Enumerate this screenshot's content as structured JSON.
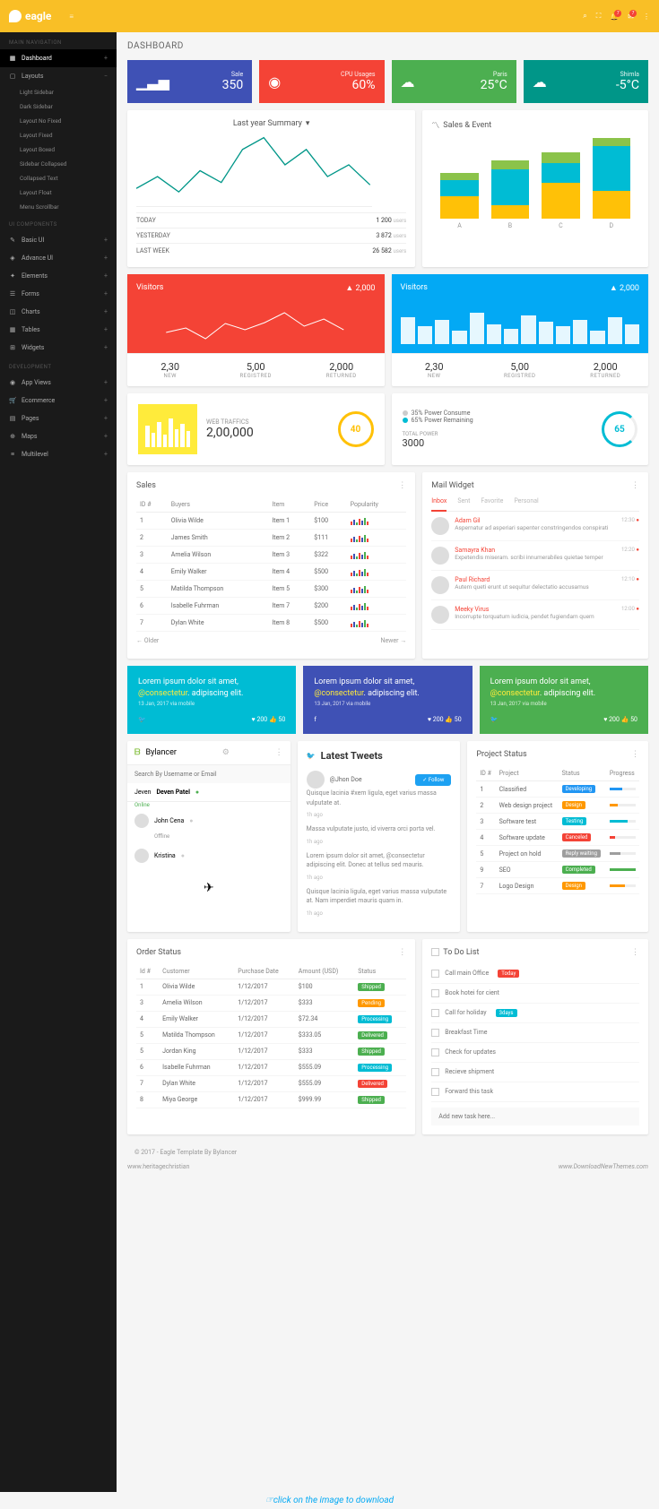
{
  "brand": "eagle",
  "topbar": {
    "notif1": "7",
    "notif2": "7"
  },
  "nav": {
    "header1": "MAIN NAVIGATION",
    "dashboard": "Dashboard",
    "layouts": "Layouts",
    "layout_sub": [
      "Light Sidebar",
      "Dark Sidebar",
      "Layout No Fixed",
      "Layout Fixed",
      "Layout Boxed",
      "Sidebar Collapsed",
      "Collapsed Text",
      "Layout Float",
      "Menu Scrollbar"
    ],
    "header2": "UI COMPONENTS",
    "items2": [
      "Basic UI",
      "Advance UI",
      "Elements",
      "Forms",
      "Charts",
      "Tables",
      "Widgets"
    ],
    "header3": "DEVELOPMENT",
    "items3": [
      "App Views",
      "Ecommerce",
      "Pages",
      "Maps",
      "Multilevel"
    ]
  },
  "page_title": "DASHBOARD",
  "stat_cards": [
    {
      "label": "Sale",
      "value": "350",
      "color": "c-blue"
    },
    {
      "label": "CPU Usages",
      "value": "60%",
      "color": "c-red"
    },
    {
      "label": "Paris",
      "value": "25°C",
      "color": "c-green"
    },
    {
      "label": "Shimla",
      "value": "-5°C",
      "color": "c-teal"
    }
  ],
  "summary": {
    "title": "Last year Summary",
    "rows": [
      {
        "label": "TODAY",
        "value": "1 200",
        "unit": "users"
      },
      {
        "label": "YESTERDAY",
        "value": "3 872",
        "unit": "users"
      },
      {
        "label": "LAST WEEK",
        "value": "26 582",
        "unit": "users"
      }
    ]
  },
  "sales_event": {
    "title": "Sales & Event",
    "labels": [
      "A",
      "B",
      "C",
      "D"
    ]
  },
  "chart_data": [
    {
      "type": "line",
      "title": "Last year Summary",
      "values": [
        25,
        40,
        20,
        45,
        30,
        60,
        85,
        50,
        72,
        40,
        55,
        35
      ]
    },
    {
      "type": "bar",
      "title": "Sales & Event",
      "categories": [
        "A",
        "B",
        "C",
        "D"
      ],
      "series": [
        {
          "name": "s1",
          "values": [
            25,
            15,
            40,
            35
          ],
          "color": "#ffc107"
        },
        {
          "name": "s2",
          "values": [
            18,
            40,
            22,
            55
          ],
          "color": "#00bcd4"
        },
        {
          "name": "s3",
          "values": [
            8,
            10,
            12,
            10
          ],
          "color": "#8bc34a"
        }
      ]
    },
    {
      "type": "line",
      "title": "Visitors-red",
      "values": [
        30,
        40,
        20,
        50,
        35,
        55,
        80,
        45,
        60,
        40
      ]
    },
    {
      "type": "bar",
      "title": "Visitors-blue",
      "values": [
        60,
        40,
        55,
        30,
        70,
        45,
        35,
        65,
        50,
        40,
        55,
        30,
        60,
        45
      ]
    }
  ],
  "visitors": {
    "title": "Visitors",
    "value": "2,000",
    "arrow": "▲",
    "cols": [
      {
        "num": "2,30",
        "lbl": "NEW"
      },
      {
        "num": "5,00",
        "lbl": "REGISTRED"
      },
      {
        "num": "2,000",
        "lbl": "RETURNED"
      }
    ]
  },
  "traffic": {
    "label": "WEB TRAFFICS",
    "value": "2,00,000",
    "circle": "40"
  },
  "power": {
    "consume": "35% Power Consume",
    "remain": "65% Power Remaining",
    "total_lbl": "TOTAL POWER",
    "total": "3000",
    "circle": "65"
  },
  "sales_table": {
    "title": "Sales",
    "cols": [
      "ID #",
      "Buyers",
      "Item",
      "Price",
      "Popularity"
    ],
    "rows": [
      {
        "id": "1",
        "buyer": "Olivia Wilde",
        "item": "Item 1",
        "price": "$100"
      },
      {
        "id": "2",
        "buyer": "James Smith",
        "item": "Item 2",
        "price": "$111"
      },
      {
        "id": "3",
        "buyer": "Amelia Wilson",
        "item": "Item 3",
        "price": "$322"
      },
      {
        "id": "4",
        "buyer": "Emily Walker",
        "item": "Item 4",
        "price": "$500"
      },
      {
        "id": "5",
        "buyer": "Matilda Thompson",
        "item": "Item 5",
        "price": "$300"
      },
      {
        "id": "6",
        "buyer": "Isabelle Fuhrman",
        "item": "Item 7",
        "price": "$200"
      },
      {
        "id": "7",
        "buyer": "Dylan White",
        "item": "Item 8",
        "price": "$500"
      }
    ],
    "older": "← Older",
    "newer": "Newer →"
  },
  "mail": {
    "title": "Mail Widget",
    "tabs": [
      "Inbox",
      "Sent",
      "Favorite",
      "Personal"
    ],
    "items": [
      {
        "name": "Adam Gil",
        "text": "Aspernatur ad asperiari sapenter constringendos conspirati",
        "time": "12:30"
      },
      {
        "name": "Samayra Khan",
        "text": "Expetendis miseram. scribi innumerabiles quietae temper",
        "time": "12:20"
      },
      {
        "name": "Paul Richard",
        "text": "Autem queti erunt ut sequitur delectatio accusamus",
        "time": "12:10"
      },
      {
        "name": "Meeky Virus",
        "text": "Incorrupte torquatum iudicia, pendet fugiendam quem",
        "time": "12:00"
      }
    ]
  },
  "social": {
    "text": "Lorem ipsum dolor sit amet,",
    "mention": "@consectetur",
    "text2": ". adipiscing elit.",
    "meta": "13 Jan, 2017 via mobile",
    "likes": "200",
    "thumbs": "50"
  },
  "chat": {
    "brand": "Bylancer",
    "placeholder": "Search By Username or Email",
    "seven": "Jeven",
    "users": [
      {
        "name": "Deven Patel",
        "status": "Online"
      },
      {
        "name": "John Cena",
        "status": "Offline"
      },
      {
        "name": "Kristina",
        "status": ""
      }
    ]
  },
  "tweets": {
    "title": "Latest Tweets",
    "handle": "@Jhon Doe",
    "follow": "Follow",
    "body": [
      "Quisque lacinia #xem ligula, eget varius massa vulputate at.",
      "1h ago",
      "Massa vulputate justo, id viverra orci porta vel.",
      "1h ago",
      "Lorem ipsum dolor sit amet, @consectetur adipiscing elit. Donec at tellus sed mauris.",
      "1h ago",
      "Quisque lacinia ligula, eget varius massa vulputate at. Nam imperdiet mauris quam in.",
      "1h ago"
    ]
  },
  "projects": {
    "title": "Project Status",
    "cols": [
      "ID #",
      "Project",
      "Status",
      "Progress"
    ],
    "rows": [
      {
        "id": "1",
        "name": "Classified",
        "status": "Developing",
        "cls": "b-blue",
        "prog": 50,
        "pcls": "b-blue"
      },
      {
        "id": "2",
        "name": "Web design project",
        "status": "Design",
        "cls": "b-orange",
        "prog": 30,
        "pcls": "b-orange"
      },
      {
        "id": "3",
        "name": "Software test",
        "status": "Testing",
        "cls": "b-cyan",
        "prog": 70,
        "pcls": "b-cyan"
      },
      {
        "id": "4",
        "name": "Software update",
        "status": "Canceled",
        "cls": "b-red",
        "prog": 20,
        "pcls": "b-red"
      },
      {
        "id": "5",
        "name": "Project on hold",
        "status": "Reply waiting",
        "cls": "b-gray",
        "prog": 40,
        "pcls": "b-gray"
      },
      {
        "id": "9",
        "name": "SEO",
        "status": "Completed",
        "cls": "b-green",
        "prog": 100,
        "pcls": "b-green"
      },
      {
        "id": "7",
        "name": "Logo Design",
        "status": "Design",
        "cls": "b-orange",
        "prog": 60,
        "pcls": "b-orange"
      }
    ]
  },
  "orders": {
    "title": "Order Status",
    "cols": [
      "Id #",
      "Customer",
      "Purchase Date",
      "Amount (USD)",
      "Status"
    ],
    "rows": [
      {
        "id": "1",
        "name": "Olivia Wilde",
        "date": "1/12/2017",
        "amt": "$100",
        "status": "Shipped",
        "cls": "b-green"
      },
      {
        "id": "3",
        "name": "Amelia Wilson",
        "date": "1/12/2017",
        "amt": "$333",
        "status": "Pending",
        "cls": "b-orange"
      },
      {
        "id": "4",
        "name": "Emily Walker",
        "date": "1/12/2017",
        "amt": "$72.34",
        "status": "Processing",
        "cls": "b-cyan"
      },
      {
        "id": "5",
        "name": "Matilda Thompson",
        "date": "1/12/2017",
        "amt": "$333.05",
        "status": "Delivered",
        "cls": "b-green"
      },
      {
        "id": "5",
        "name": "Jordan King",
        "date": "1/12/2017",
        "amt": "$333",
        "status": "Shipped",
        "cls": "b-green"
      },
      {
        "id": "6",
        "name": "Isabelle Fuhrman",
        "date": "1/12/2017",
        "amt": "$555.09",
        "status": "Processing",
        "cls": "b-cyan"
      },
      {
        "id": "7",
        "name": "Dylan White",
        "date": "1/12/2017",
        "amt": "$555.09",
        "status": "Delivered",
        "cls": "b-red"
      },
      {
        "id": "8",
        "name": "Miya George",
        "date": "1/12/2017",
        "amt": "$999.99",
        "status": "Shipped",
        "cls": "b-green"
      }
    ]
  },
  "todo": {
    "title": "To Do List",
    "items": [
      {
        "text": "Call main Office",
        "badge": "Today",
        "cls": "b-red"
      },
      {
        "text": "Book hotei for cient"
      },
      {
        "text": "Call for holiday",
        "badge": "3days",
        "cls": "b-cyan"
      },
      {
        "text": "Breakfast Time"
      },
      {
        "text": "Check for updates"
      },
      {
        "text": "Recieve shipment"
      },
      {
        "text": "Forward this task"
      }
    ],
    "placeholder": "Add new task here..."
  },
  "footer": "© 2017 - Eagle Template By Bylancer",
  "watermark1": "www.heritagechristian",
  "watermark2": "www.DownloadNewThemes.com",
  "hint": "☞click on the image to download"
}
